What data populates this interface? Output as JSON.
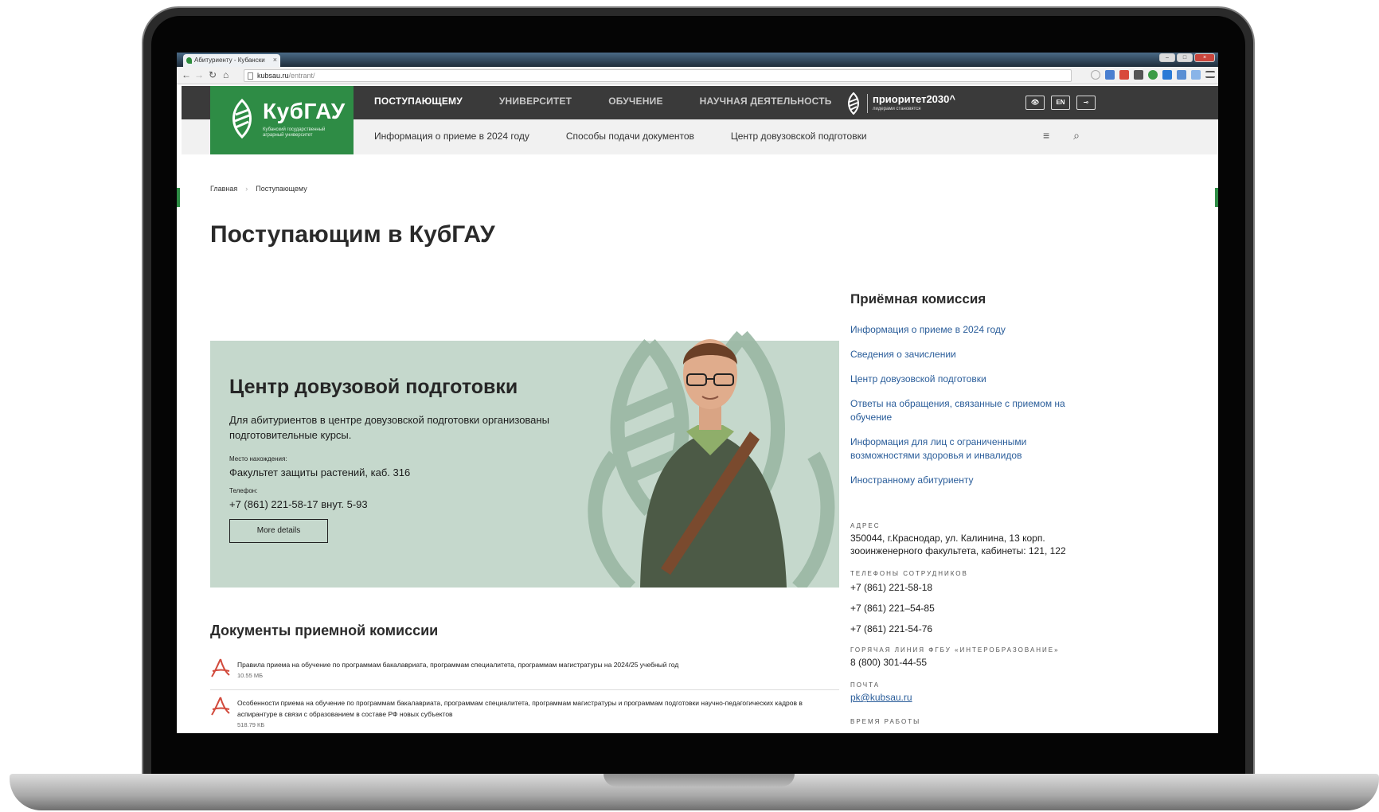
{
  "browser": {
    "tab_title": "Абитуриенту - Кубански",
    "tab_close": "×",
    "url_host": "kubsau.ru",
    "url_path": "/entrant/"
  },
  "header": {
    "logo_title": "КубГАУ",
    "logo_subtitle": "Кубанский государственный аграрный университет",
    "menu": [
      "ПОСТУПАЮЩЕМУ",
      "УНИВЕРСИТЕТ",
      "ОБУЧЕНИЕ",
      "НАУЧНАЯ ДЕЯТЕЛЬНОСТЬ"
    ],
    "priority_title": "приоритет2030^",
    "priority_subtitle": "лидерами становятся",
    "lang_button": "EN",
    "submenu": [
      "Информация о приеме в 2024 году",
      "Способы подачи документов",
      "Центр довузовской подготовки"
    ],
    "brand_color": "#2e8c45"
  },
  "breadcrumb": {
    "home": "Главная",
    "sep": "›",
    "current": "Поступающему"
  },
  "page_title": "Поступающим в КубГАУ",
  "promo": {
    "title": "Центр довузовой подготовки",
    "description": "Для абитуриентов в центре довузовской подготовки организованы подготовительные курсы.",
    "location_label": "Место нахождения:",
    "location_value": "Факультет защиты растений, каб. 316",
    "phone_label": "Телефон:",
    "phone_value": "+7 (861) 221-58-17 внут. 5-93",
    "button": "More details",
    "bg_color": "#c5d8cc"
  },
  "documents": {
    "title": "Документы приемной комиссии",
    "items": [
      {
        "title": "Правила приема на обучение по программам бакалавриата, программам специалитета, программам магистратуры на 2024/25 учебный год",
        "size": "10.55 МБ"
      },
      {
        "title": "Особенности приема на обучение по программам бакалавриата, программам специалитета, программам магистратуры и программам подготовки научно-педагогических кадров в аспирантуре в связи с образованием в составе РФ новых субъектов",
        "size": "518.79 КБ"
      }
    ]
  },
  "sidebar": {
    "title": "Приёмная комиссия",
    "links": [
      "Информация о приеме в 2024 году",
      "Сведения о зачислении",
      "Центр довузовской подготовки",
      "Ответы на обращения, связанные с приемом на обучение",
      "Информация для лиц с ограниченными возможностями здоровья и инвалидов",
      "Иностранному абитуриенту"
    ],
    "address_label": "АДРЕС",
    "address_value": "350044, г.Краснодар, ул. Калинина, 13 корп. зооинженерного факультета, кабинеты: 121, 122",
    "phones_label": "ТЕЛЕФОНЫ СОТРУДНИКОВ",
    "phones": [
      "+7 (861) 221-58-18",
      "+7 (861) 221–54-85",
      "+7 (861) 221-54-76"
    ],
    "hotline_label": "ГОРЯЧАЯ ЛИНИЯ ФГБУ «ИНТЕРОБРАЗОВАНИЕ»",
    "hotline_value": "8 (800) 301-44-55",
    "email_label": "ПОЧТА",
    "email_value": "pk@kubsau.ru",
    "hours_label": "ВРЕМЯ РАБОТЫ",
    "link_color": "#2a5d9a"
  }
}
